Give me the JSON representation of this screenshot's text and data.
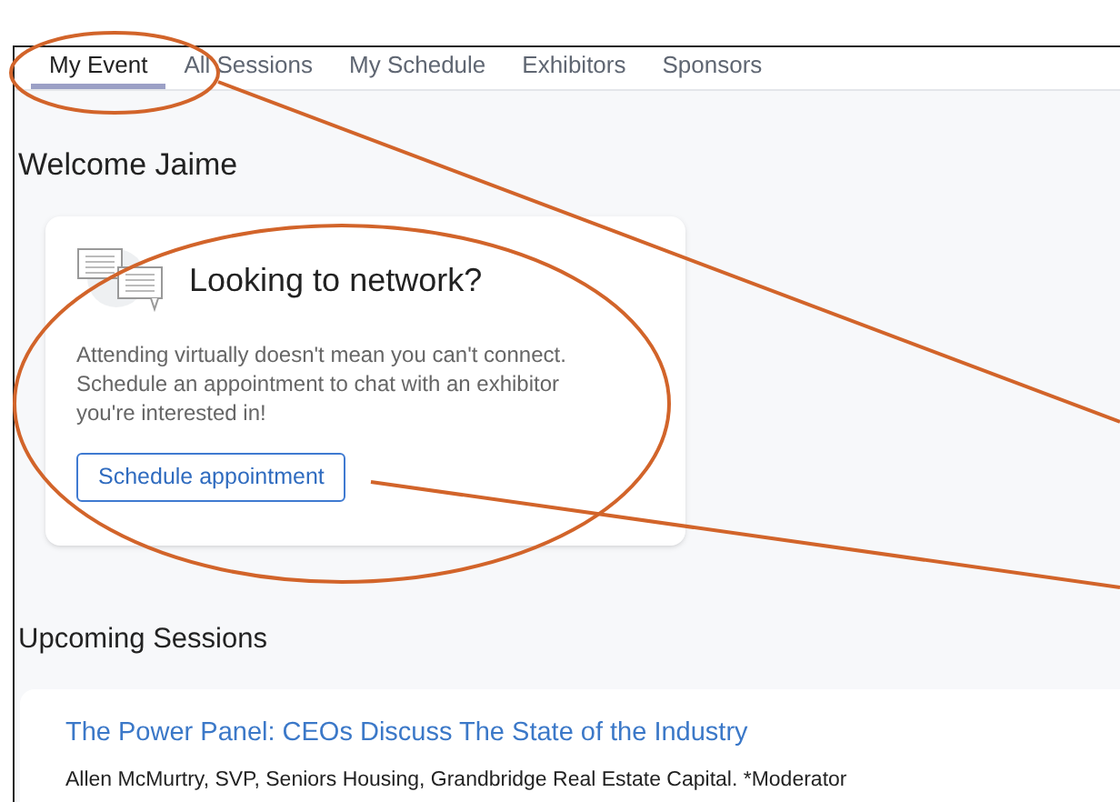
{
  "tabs": [
    {
      "label": "My Event",
      "selected": true
    },
    {
      "label": "All Sessions",
      "selected": false
    },
    {
      "label": "My Schedule",
      "selected": false
    },
    {
      "label": "Exhibitors",
      "selected": false
    },
    {
      "label": "Sponsors",
      "selected": false
    }
  ],
  "welcome": "Welcome Jaime",
  "network_card": {
    "title": "Looking to network?",
    "text": "Attending virtually doesn't mean you can't connect. Schedule an appointment to chat with an exhibitor you're interested in!",
    "button": "Schedule appointment"
  },
  "upcoming": {
    "heading": "Upcoming Sessions",
    "sessions": [
      {
        "title": "The Power Panel: CEOs Discuss The State of the Industry",
        "speakers": "Allen McMurtry, SVP, Seniors Housing, Grandbridge Real Estate Capital. *Moderator"
      }
    ]
  }
}
